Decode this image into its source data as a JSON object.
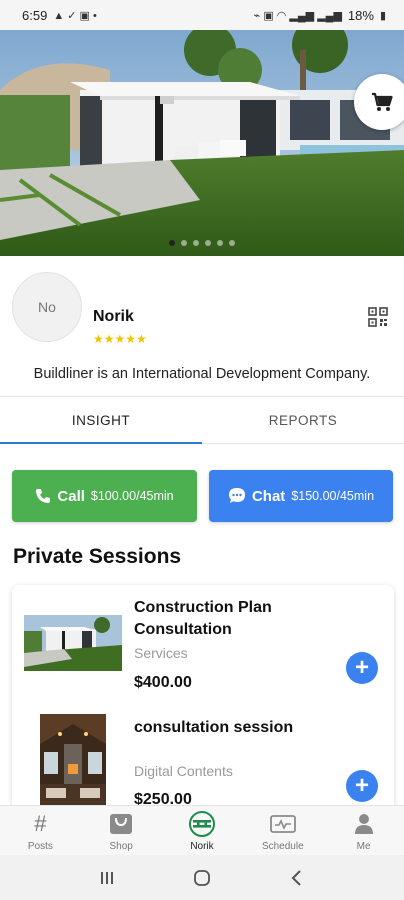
{
  "status_bar": {
    "time": "6:59",
    "battery": "18%"
  },
  "hero": {
    "slide_count": 6,
    "active_slide": 0
  },
  "profile": {
    "avatar_initials": "No",
    "name": "Norik",
    "rating_stars": "★★★★★",
    "bio": "Buildliner is an International Development Company."
  },
  "tabs": [
    {
      "label": "INSIGHT",
      "active": true
    },
    {
      "label": "REPORTS",
      "active": false
    }
  ],
  "actions": {
    "call": {
      "label": "Call",
      "price": "$100.00/45min",
      "color": "#4caf50"
    },
    "chat": {
      "label": "Chat",
      "price": "$150.00/45min",
      "color": "#3b82f0"
    }
  },
  "private_sessions": {
    "title": "Private Sessions",
    "items": [
      {
        "title": "Construction Plan Consultation",
        "category": "Services",
        "price": "$400.00"
      },
      {
        "title": "consultation session",
        "category": "Digital Contents",
        "price": "$250.00"
      }
    ]
  },
  "bottom_nav": [
    {
      "label": "Posts",
      "icon": "hash-icon",
      "active": false
    },
    {
      "label": "Shop",
      "icon": "shop-bag-icon",
      "active": false
    },
    {
      "label": "Norik",
      "icon": "brand-logo-icon",
      "active": true
    },
    {
      "label": "Schedule",
      "icon": "schedule-icon",
      "active": false
    },
    {
      "label": "Me",
      "icon": "person-icon",
      "active": false
    }
  ],
  "colors": {
    "accent_blue": "#3b82f0",
    "call_green": "#4caf50",
    "brand_green": "#1f8a4c",
    "star_yellow": "#f2c300"
  }
}
